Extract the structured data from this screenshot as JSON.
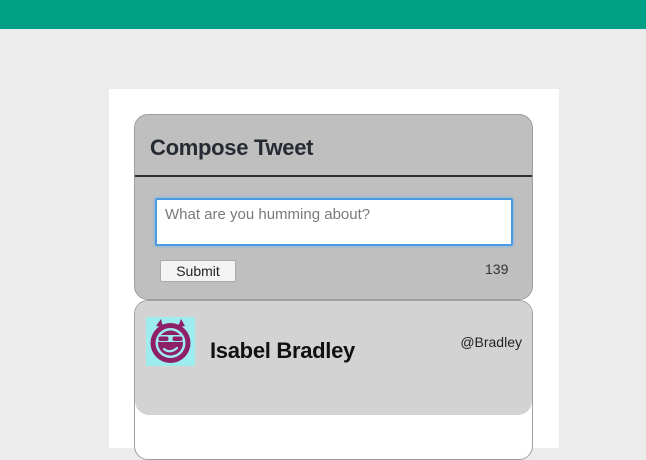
{
  "compose": {
    "title": "Compose Tweet",
    "placeholder": "What are you humming about?",
    "submit_label": "Submit",
    "char_count": "139"
  },
  "tweet": {
    "user_name": "Isabel Bradley",
    "handle": "@Bradley",
    "avatar_icon": "cool-face-icon"
  },
  "colors": {
    "topbar": "#00a086",
    "compose_bg": "#bfbfbf",
    "tweet_header_bg": "#d3d3d3",
    "avatar_bg": "#9fecef",
    "avatar_face": "#8e2068"
  }
}
